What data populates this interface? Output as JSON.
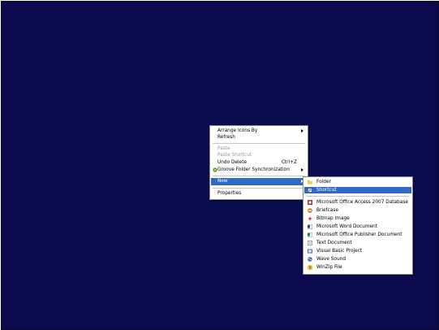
{
  "context_menu": {
    "arrange_icons_by": "Arrange Icons By",
    "refresh": "Refresh",
    "paste": "Paste",
    "paste_shortcut": "Paste Shortcut",
    "undo_delete": "Undo Delete",
    "undo_delete_shortcut": "Ctrl+Z",
    "groove_sync": "Groove Folder Synchronization",
    "new": "New",
    "properties": "Properties"
  },
  "new_submenu": {
    "folder": "Folder",
    "shortcut": "Shortcut",
    "items": [
      {
        "label": "Microsoft Office Access 2007 Database",
        "icon": "access-database-icon"
      },
      {
        "label": "Briefcase",
        "icon": "briefcase-icon"
      },
      {
        "label": "Bitmap Image",
        "icon": "bitmap-image-icon"
      },
      {
        "label": "Microsoft Word Document",
        "icon": "word-document-icon"
      },
      {
        "label": "Microsoft Office Publisher Document",
        "icon": "publisher-document-icon"
      },
      {
        "label": "Text Document",
        "icon": "text-document-icon"
      },
      {
        "label": "Visual Basic Project",
        "icon": "visual-basic-project-icon"
      },
      {
        "label": "Wave Sound",
        "icon": "wave-sound-icon"
      },
      {
        "label": "WinZip File",
        "icon": "winzip-file-icon"
      }
    ]
  },
  "colors": {
    "desktop_background": "#0a0a4e",
    "selection_highlight": "#316ac5",
    "disabled_text": "#9a9a9a"
  }
}
